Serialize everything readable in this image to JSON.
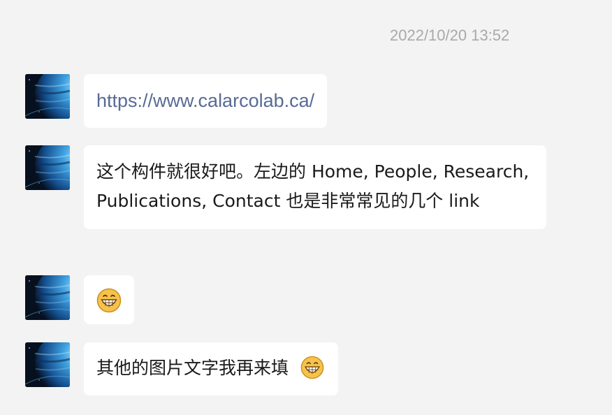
{
  "chat": {
    "timestamp": "2022/10/20 13:52",
    "messages": [
      {
        "type": "link",
        "text": "https://www.calarcolab.ca/"
      },
      {
        "type": "text",
        "text": "这个构件就很好吧。左边的 Home, People, Research, Publications, Contact 也是非常常见的几个 link"
      },
      {
        "type": "emoji",
        "emoji": "grinning-face-emoji"
      },
      {
        "type": "text",
        "text": "其他的图片文字我再来填",
        "trailing_emoji": "grinning-face-emoji"
      }
    ]
  },
  "colors": {
    "background": "#f3f3f3",
    "bubble": "#ffffff",
    "link": "#576b95",
    "timestamp": "#a9a9a9"
  }
}
